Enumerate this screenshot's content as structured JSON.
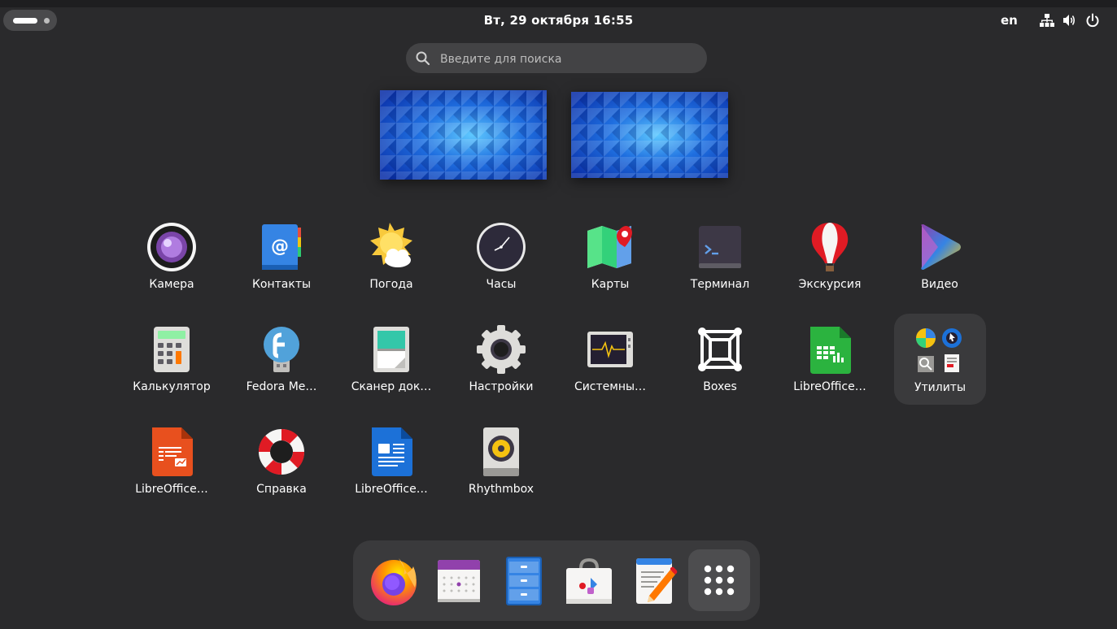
{
  "topbar": {
    "clock": "Вт, 29 октября  16:55",
    "language": "en"
  },
  "search": {
    "placeholder": "Введите для поиска"
  },
  "apps": {
    "camera": "Камера",
    "contacts": "Контакты",
    "weather": "Погода",
    "clocks": "Часы",
    "maps": "Карты",
    "terminal": "Терминал",
    "tour": "Экскурсия",
    "video": "Видео",
    "calculator": "Калькулятор",
    "fedora_media": "Fedora Me…",
    "scanner": "Сканер док…",
    "settings": "Настройки",
    "system_monitor": "Системны…",
    "boxes": "Boxes",
    "lo_calc": "LibreOffice…",
    "utilities": "Утилиты",
    "lo_impress": "LibreOffice…",
    "help": "Справка",
    "lo_writer": "LibreOffice…",
    "rhythmbox": "Rhythmbox"
  },
  "colors": {
    "background": "#2a2a2c",
    "search_bg": "#434345",
    "dash_bg": "#3a3a3c"
  }
}
